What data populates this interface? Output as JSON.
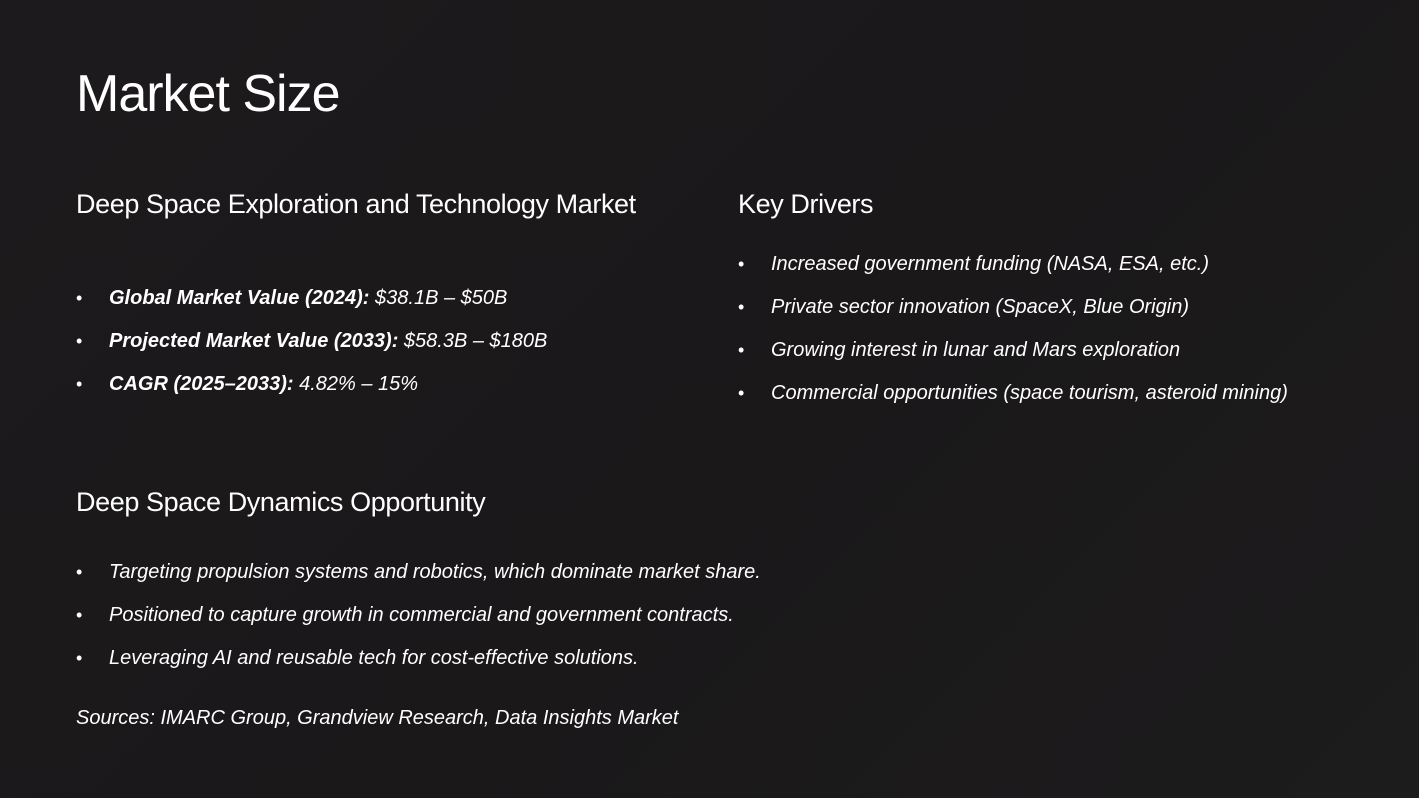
{
  "slide": {
    "title": "Market Size",
    "market": {
      "heading": "Deep Space Exploration and Technology Market",
      "items": [
        {
          "label": "Global Market Value (2024):",
          "value": " $38.1B – $50B"
        },
        {
          "label": "Projected Market Value (2033):",
          "value": " $58.3B – $180B"
        },
        {
          "label": "CAGR (2025–2033):",
          "value": " 4.82% – 15%"
        }
      ]
    },
    "drivers": {
      "heading": "Key Drivers",
      "items": [
        "Increased government funding (NASA, ESA, etc.)",
        "Private sector innovation (SpaceX, Blue Origin)",
        "Growing interest in lunar and Mars exploration",
        "Commercial opportunities (space tourism, asteroid mining)"
      ]
    },
    "opportunity": {
      "heading": "Deep Space Dynamics Opportunity",
      "items": [
        "Targeting propulsion systems and robotics, which dominate market share.",
        "Positioned to capture growth in commercial and government contracts.",
        "Leveraging AI and reusable tech for cost-effective solutions."
      ]
    },
    "sources": "Sources: IMARC Group, Grandview Research, Data Insights Market",
    "bullet_glyph": "•",
    "colors": {
      "background": "#1b191a",
      "text": "#ffffff"
    }
  }
}
